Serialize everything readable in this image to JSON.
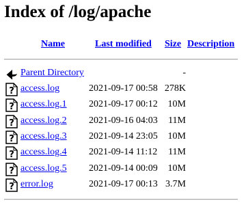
{
  "page": {
    "title": "Index of /log/apache"
  },
  "columns": {
    "name": "Name",
    "last_modified": "Last modified",
    "size": "Size",
    "description": "Description"
  },
  "parent": {
    "label": "Parent Directory",
    "size": "-",
    "icon": "back-arrow-icon"
  },
  "files": [
    {
      "name": "access.log",
      "modified": "2021-09-17 00:58",
      "size": "278K",
      "icon": "unknown-file-icon"
    },
    {
      "name": "access.log.1",
      "modified": "2021-09-17 00:12",
      "size": "10M",
      "icon": "unknown-file-icon"
    },
    {
      "name": "access.log.2",
      "modified": "2021-09-16 04:03",
      "size": "11M",
      "icon": "unknown-file-icon"
    },
    {
      "name": "access.log.3",
      "modified": "2021-09-14 23:05",
      "size": "10M",
      "icon": "unknown-file-icon"
    },
    {
      "name": "access.log.4",
      "modified": "2021-09-14 11:12",
      "size": "11M",
      "icon": "unknown-file-icon"
    },
    {
      "name": "access.log.5",
      "modified": "2021-09-14 00:09",
      "size": "10M",
      "icon": "unknown-file-icon"
    },
    {
      "name": "error.log",
      "modified": "2021-09-17 00:13",
      "size": "3.7M",
      "icon": "unknown-file-icon"
    }
  ],
  "colors": {
    "link": "#0000ee",
    "text": "#000000",
    "rule": "#a8a8a8"
  }
}
